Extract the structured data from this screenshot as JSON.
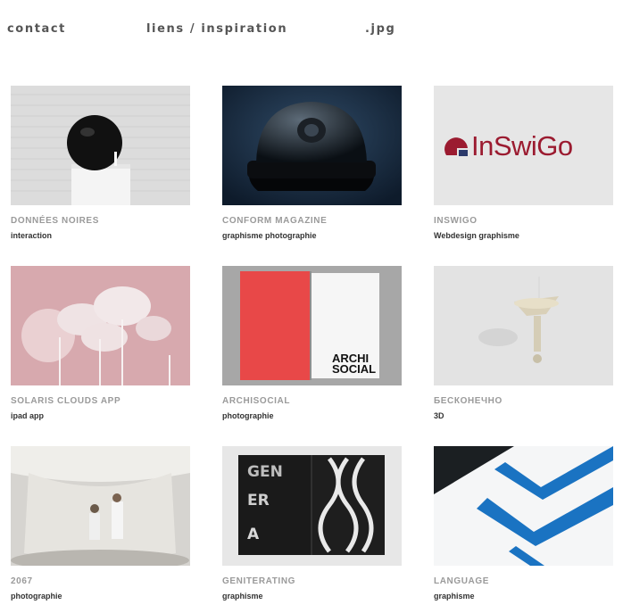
{
  "nav": {
    "contact": "contact",
    "links": "liens / inspiration",
    "jpg": ".jpg"
  },
  "logo_text": "InSwiGo",
  "projects": [
    {
      "title": "DONNÉES NOIRES",
      "tags": "interaction"
    },
    {
      "title": "CONFORM MAGAZINE",
      "tags": "graphisme photographie"
    },
    {
      "title": "INSWIGO",
      "tags": "Webdesign graphisme"
    },
    {
      "title": "SOLARIS CLOUDS APP",
      "tags": "ipad app"
    },
    {
      "title": "ARCHISOCIAL",
      "tags": "photographie"
    },
    {
      "title": "БЕСКОНЕЧНО",
      "tags": "3D"
    },
    {
      "title": "2067",
      "tags": "photographie"
    },
    {
      "title": "GENITERATING",
      "tags": "graphisme"
    },
    {
      "title": "LANGUAGE",
      "tags": "graphisme"
    }
  ],
  "colors": {
    "inswigo_red": "#9b1b30",
    "language_blue": "#1a73c2",
    "archi_red": "#e94b4b"
  }
}
